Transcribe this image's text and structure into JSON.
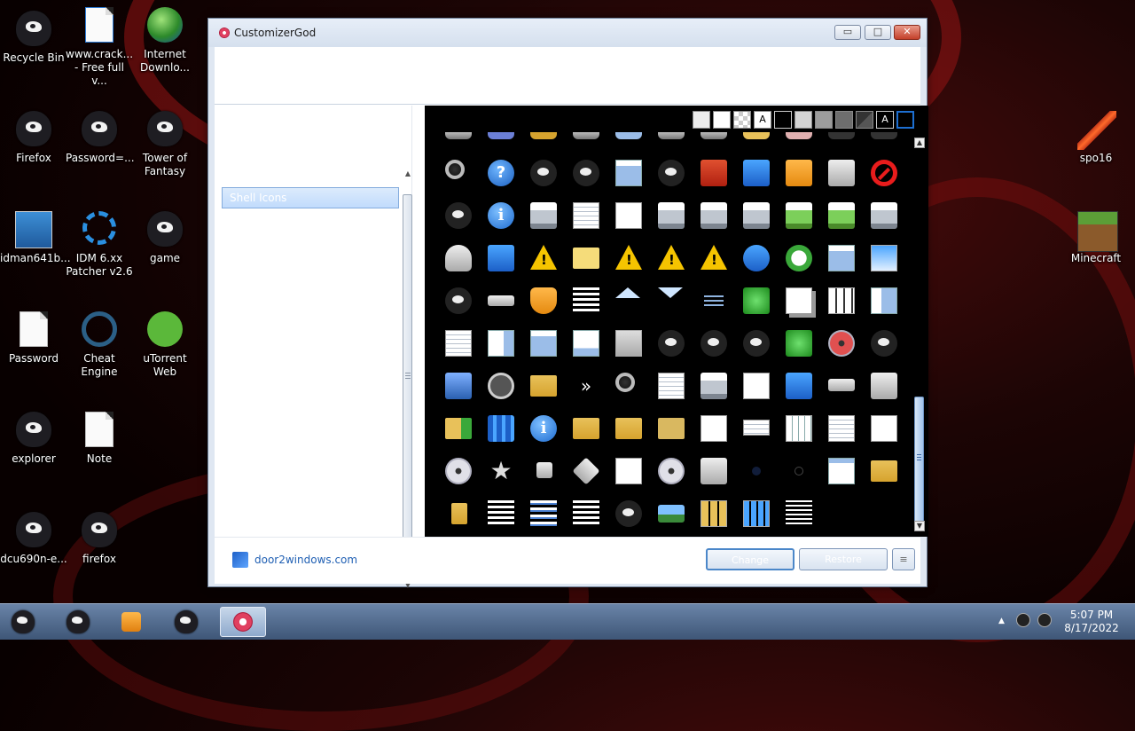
{
  "desktop_icons": [
    {
      "label": "Recycle Bin",
      "icon": "ghost-icon"
    },
    {
      "label": "www.crack... - Free full v...",
      "icon": "ie-document-icon"
    },
    {
      "label": "Internet Downlo...",
      "icon": "globe-icon"
    },
    {
      "label": "Firefox",
      "icon": "ghost-icon"
    },
    {
      "label": "Password=...",
      "icon": "ghost-icon"
    },
    {
      "label": "Tower of Fantasy",
      "icon": "ghost-icon"
    },
    {
      "label": "idman641b...",
      "icon": "installer-icon"
    },
    {
      "label": "IDM 6.xx Patcher v2.6",
      "icon": "patcher-icon"
    },
    {
      "label": "game",
      "icon": "ghost-icon"
    },
    {
      "label": "Password",
      "icon": "text-file-icon"
    },
    {
      "label": "Cheat Engine",
      "icon": "cheat-engine-icon"
    },
    {
      "label": "uTorrent Web",
      "icon": "utorrent-icon"
    },
    {
      "label": "explorer",
      "icon": "ghost-icon"
    },
    {
      "label": "Note",
      "icon": "text-file-icon"
    },
    {
      "label": "dcu690n-e...",
      "icon": "ghost-icon"
    },
    {
      "label": "firefox",
      "icon": "ghost-icon"
    },
    {
      "label": "spo16",
      "icon": "sword-icon"
    },
    {
      "label": "Minecraft",
      "icon": "minecraft-icon"
    }
  ],
  "window": {
    "title": "CustomizerGod",
    "minimize_glyph": "▭",
    "maximize_glyph": "□",
    "close_glyph": "✕"
  },
  "left_list": {
    "items": [
      "Shell Icons"
    ],
    "selected": "Shell Icons"
  },
  "palette": {
    "swatches": [
      "#ececec",
      "#ffffff",
      "checker",
      "A",
      "#000000",
      "#d4d4d4",
      "#9c9c9c",
      "#6e6e6e",
      "#3a3a3a",
      "A",
      "#1d6fd1"
    ],
    "letter_glyph": "A"
  },
  "footer": {
    "link": "door2windows.com",
    "change_label": "Change",
    "restore_label": "Restore",
    "more_glyph": "≡"
  },
  "taskbar": {
    "time": "5:07 PM",
    "date": "8/17/2022",
    "tray_expand_glyph": "▲"
  }
}
